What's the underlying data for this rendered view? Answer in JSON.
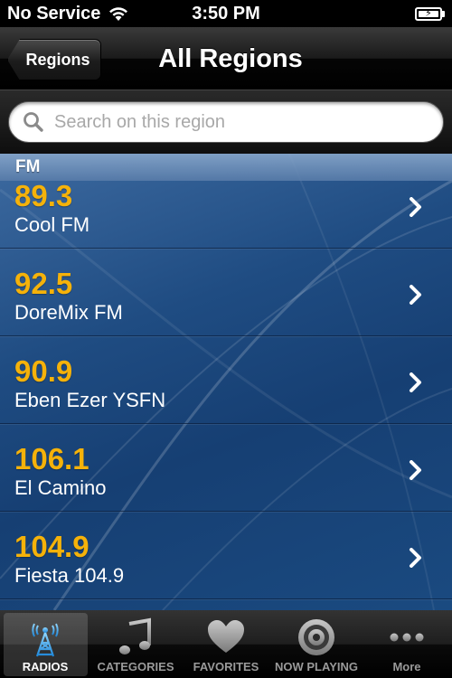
{
  "status_bar": {
    "carrier": "No Service",
    "time": "3:50 PM"
  },
  "nav": {
    "back_label": "Regions",
    "title": "All Regions"
  },
  "search": {
    "placeholder": "Search on this region"
  },
  "section": {
    "header": "FM"
  },
  "stations": [
    {
      "freq": "89.3",
      "name": "Cool FM"
    },
    {
      "freq": "92.5",
      "name": "DoreMix FM"
    },
    {
      "freq": "90.9",
      "name": "Eben Ezer YSFN"
    },
    {
      "freq": "106.1",
      "name": "El Camino"
    },
    {
      "freq": "104.9",
      "name": "Fiesta 104.9"
    }
  ],
  "tabs": [
    {
      "label": "RADIOS",
      "icon": "radio-tower-icon",
      "active": true
    },
    {
      "label": "CATEGORIES",
      "icon": "music-note-icon",
      "active": false
    },
    {
      "label": "FAVORITES",
      "icon": "heart-icon",
      "active": false
    },
    {
      "label": "NOW PLAYING",
      "icon": "speaker-icon",
      "active": false
    },
    {
      "label": "More",
      "icon": "more-dots-icon",
      "active": false
    }
  ],
  "colors": {
    "frequency": "#f5b20a",
    "list_background": "#1f4c82"
  }
}
